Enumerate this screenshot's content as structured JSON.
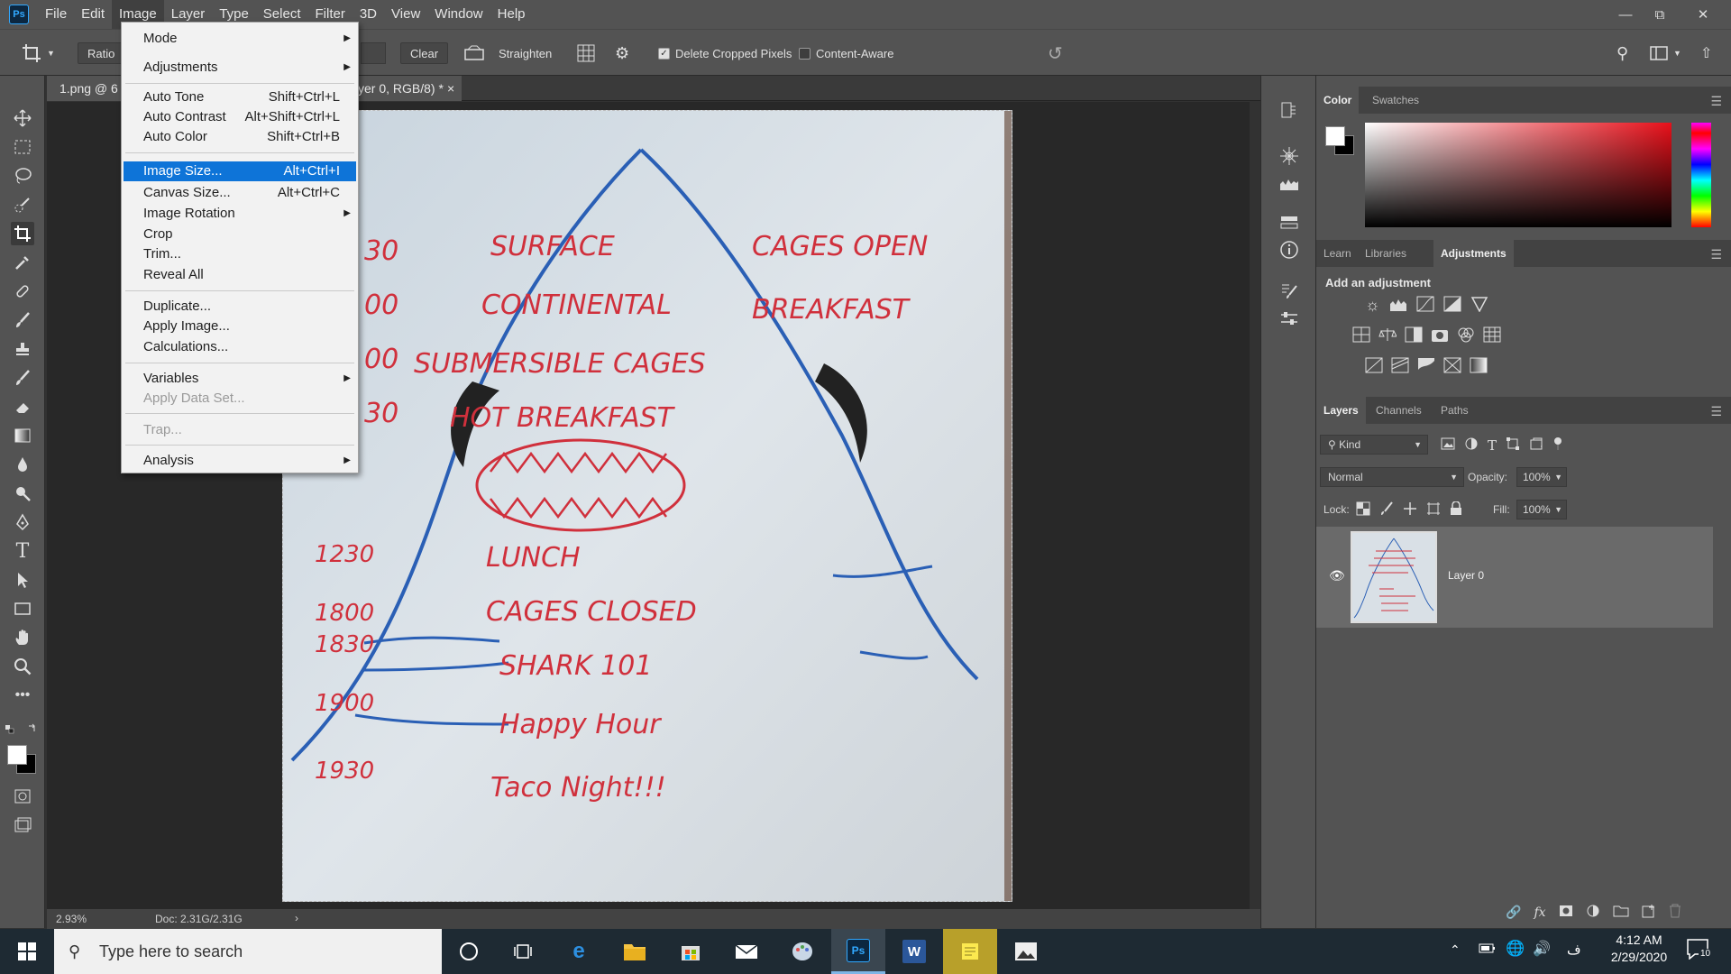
{
  "menubar": {
    "app_logo": "Ps",
    "items": [
      "File",
      "Edit",
      "Image",
      "Layer",
      "Type",
      "Select",
      "Filter",
      "3D",
      "View",
      "Window",
      "Help"
    ],
    "active": "Image"
  },
  "options_bar": {
    "ratio_label": "Ratio",
    "clear_label": "Clear",
    "straighten_label": "Straighten",
    "delete_cropped_label": "Delete Cropped Pixels",
    "delete_cropped_checked": true,
    "content_aware_label": "Content-Aware",
    "content_aware_checked": false
  },
  "document": {
    "tab_title_left": "1.png @ 6",
    "tab_title_right": "yer 0, RGB/8) *",
    "close": "×",
    "zoom": "2.93%",
    "doc_size": "Doc: 2.31G/2.31G",
    "whiteboard": {
      "times": [
        "30",
        "00",
        "00",
        "30",
        "1230",
        "1800",
        "1830",
        "1900",
        "1930"
      ],
      "lines": [
        "SURFACE",
        "CAGES OPEN",
        "CONTINENTAL",
        "BREAKFAST",
        "SUBMERSIBLE CAGES",
        "HOT BREAKFAST",
        "LUNCH",
        "CAGES CLOSED",
        "SHARK 101",
        "Happy Hour",
        "Taco Night!!!"
      ]
    }
  },
  "image_menu": {
    "items": [
      {
        "label": "Mode",
        "shortcut": "",
        "submenu": true
      },
      {
        "label": "Adjustments",
        "shortcut": "",
        "submenu": true
      },
      {
        "label": "Auto Tone",
        "shortcut": "Shift+Ctrl+L"
      },
      {
        "label": "Auto Contrast",
        "shortcut": "Alt+Shift+Ctrl+L"
      },
      {
        "label": "Auto Color",
        "shortcut": "Shift+Ctrl+B"
      },
      {
        "label": "Image Size...",
        "shortcut": "Alt+Ctrl+I",
        "highlighted": true
      },
      {
        "label": "Canvas Size...",
        "shortcut": "Alt+Ctrl+C"
      },
      {
        "label": "Image Rotation",
        "shortcut": "",
        "submenu": true
      },
      {
        "label": "Crop",
        "shortcut": ""
      },
      {
        "label": "Trim...",
        "shortcut": ""
      },
      {
        "label": "Reveal All",
        "shortcut": ""
      },
      {
        "label": "Duplicate...",
        "shortcut": ""
      },
      {
        "label": "Apply Image...",
        "shortcut": ""
      },
      {
        "label": "Calculations...",
        "shortcut": ""
      },
      {
        "label": "Variables",
        "shortcut": "",
        "submenu": true
      },
      {
        "label": "Apply Data Set...",
        "shortcut": "",
        "disabled": true
      },
      {
        "label": "Trap...",
        "shortcut": "",
        "disabled": true
      },
      {
        "label": "Analysis",
        "shortcut": "",
        "submenu": true
      }
    ]
  },
  "color_panel": {
    "tabs": [
      "Color",
      "Swatches"
    ],
    "active_tab": "Color",
    "hue_color": "#e8101a"
  },
  "adjustments_panel": {
    "tabs": [
      "Learn",
      "Libraries",
      "Adjustments"
    ],
    "active_tab": "Adjustments",
    "heading": "Add an adjustment"
  },
  "layers_panel": {
    "tabs": [
      "Layers",
      "Channels",
      "Paths"
    ],
    "active_tab": "Layers",
    "filter_label": "Kind",
    "blend_mode": "Normal",
    "opacity_label": "Opacity:",
    "opacity_value": "100%",
    "lock_label": "Lock:",
    "fill_label": "Fill:",
    "fill_value": "100%",
    "layers": [
      {
        "name": "Layer 0",
        "visible": true
      }
    ]
  },
  "taskbar": {
    "search_placeholder": "Type here to search",
    "time": "4:12 AM",
    "date": "2/29/2020",
    "notification_count": "10"
  }
}
